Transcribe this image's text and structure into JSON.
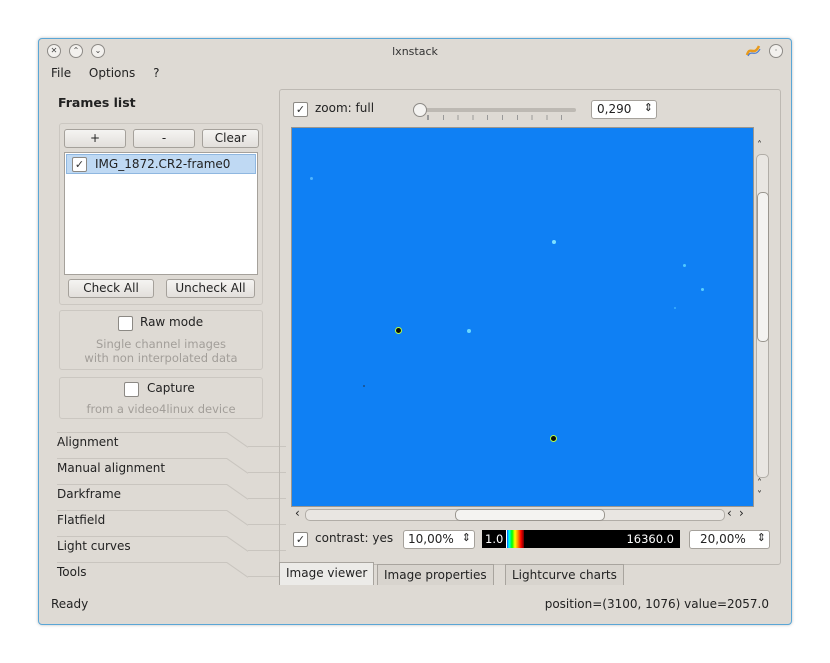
{
  "window": {
    "title": "lxnstack"
  },
  "menu": {
    "file": "File",
    "options": "Options",
    "help": "?"
  },
  "frames": {
    "heading": "Frames list",
    "add_label": "+",
    "remove_label": "-",
    "clear_label": "Clear",
    "items": [
      {
        "label": "IMG_1872.CR2-frame0",
        "checked": true
      }
    ],
    "check_all_label": "Check All",
    "uncheck_all_label": "Uncheck All"
  },
  "raw_mode": {
    "label": "Raw mode",
    "desc_line1": "Single channel images",
    "desc_line2": "with non interpolated data"
  },
  "capture": {
    "label": "Capture",
    "desc": "from a video4linux device"
  },
  "sections": [
    "Alignment",
    "Manual alignment",
    "Darkframe",
    "Flatfield",
    "Light curves",
    "Tools"
  ],
  "zoom": {
    "label": "zoom: full",
    "checked": true,
    "value": "0,290",
    "slider_fraction": 0.0
  },
  "contrast": {
    "label": "contrast: yes",
    "checked": true,
    "low": "10,00%",
    "high": "20,00%",
    "range_min": "1.0",
    "range_max": "16360.0"
  },
  "tabs": [
    {
      "label": "Image viewer",
      "active": true
    },
    {
      "label": "Image properties",
      "active": false
    },
    {
      "label": "Lightcurve charts",
      "active": false
    }
  ],
  "status": {
    "left": "Ready",
    "right": "position=(3100, 1076) value=2057.0"
  },
  "colors": {
    "viewer_bg": "#0f80f4",
    "window_border": "#5aa6d6",
    "selection": "#bfd9f3"
  }
}
